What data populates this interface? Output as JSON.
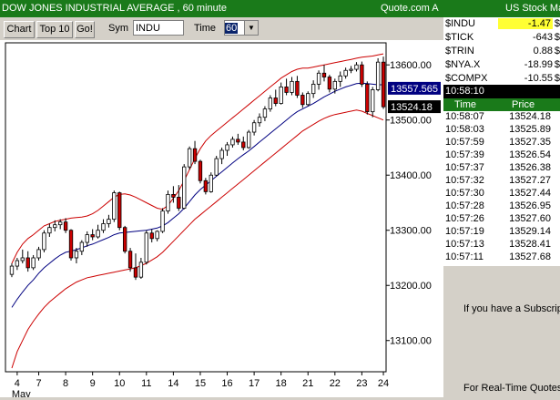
{
  "window": {
    "title": "DOW JONES INDUSTRIAL AVERAGE  , 60 minute",
    "source": "Quote.com",
    "source_suffix": "A"
  },
  "toolbar": {
    "chart_label": "Chart",
    "top10_label": "Top 10",
    "go_label": "Go!",
    "sym_label": "Sym",
    "sym_value": "INDU",
    "time_label": "Time",
    "time_value": "60"
  },
  "price_labels": {
    "upper": "13557.565",
    "last": "13524.18"
  },
  "right_panel": {
    "title": "US Stock Ma",
    "quotes": [
      {
        "symbol": "$INDU",
        "value": "-1.47",
        "highlight": true
      },
      {
        "symbol": "$TICK",
        "value": "-643",
        "highlight": false
      },
      {
        "symbol": "$TRIN",
        "value": "0.88",
        "highlight": false
      },
      {
        "symbol": "$NYA.X",
        "value": "-18.99",
        "highlight": false
      },
      {
        "symbol": "$COMPX",
        "value": "-10.55",
        "highlight": false
      }
    ],
    "clock": "10:58:10",
    "ts_headers": {
      "time": "Time",
      "price": "Price"
    },
    "time_sales": [
      {
        "time": "10:58:07",
        "price": "13524.18"
      },
      {
        "time": "10:58:03",
        "price": "13525.89"
      },
      {
        "time": "10:57:59",
        "price": "13527.35"
      },
      {
        "time": "10:57:39",
        "price": "13526.54"
      },
      {
        "time": "10:57:37",
        "price": "13526.38"
      },
      {
        "time": "10:57:32",
        "price": "13527.27"
      },
      {
        "time": "10:57:30",
        "price": "13527.44"
      },
      {
        "time": "10:57:28",
        "price": "13526.95"
      },
      {
        "time": "10:57:26",
        "price": "13527.60"
      },
      {
        "time": "10:57:19",
        "price": "13529.14"
      },
      {
        "time": "10:57:13",
        "price": "13528.41"
      },
      {
        "time": "10:57:11",
        "price": "13527.68"
      }
    ],
    "subscribe_text": "If you have a Subscript",
    "realtime_text": "For Real-Time Quotes"
  },
  "chart_data": {
    "type": "candlestick",
    "ylim": [
      13050,
      13640
    ],
    "y_ticks": [
      "13600.00",
      "13500.00",
      "13400.00",
      "13300.00",
      "13200.00",
      "13100.00"
    ],
    "x_ticks": [
      "4",
      "7",
      "8",
      "9",
      "10",
      "11",
      "14",
      "15",
      "16",
      "17",
      "18",
      "21",
      "22",
      "23",
      "24"
    ],
    "x_sublabel": "May",
    "bullish_color": "#ffffff",
    "bearish_color": "#cc0000",
    "band_color": "#cc0000",
    "ma_color": "#000080",
    "candles": [
      [
        13220,
        13240,
        13215,
        13235
      ],
      [
        13235,
        13250,
        13228,
        13245
      ],
      [
        13245,
        13265,
        13240,
        13250
      ],
      [
        13250,
        13262,
        13225,
        13232
      ],
      [
        13232,
        13255,
        13228,
        13250
      ],
      [
        13250,
        13270,
        13245,
        13265
      ],
      [
        13265,
        13300,
        13260,
        13295
      ],
      [
        13295,
        13312,
        13288,
        13305
      ],
      [
        13305,
        13318,
        13298,
        13310
      ],
      [
        13310,
        13320,
        13302,
        13315
      ],
      [
        13315,
        13322,
        13295,
        13300
      ],
      [
        13300,
        13302,
        13245,
        13250
      ],
      [
        13250,
        13268,
        13240,
        13262
      ],
      [
        13262,
        13282,
        13255,
        13278
      ],
      [
        13278,
        13298,
        13270,
        13292
      ],
      [
        13292,
        13302,
        13282,
        13288
      ],
      [
        13288,
        13310,
        13285,
        13300
      ],
      [
        13300,
        13320,
        13295,
        13312
      ],
      [
        13312,
        13328,
        13305,
        13320
      ],
      [
        13320,
        13372,
        13315,
        13368
      ],
      [
        13368,
        13370,
        13300,
        13305
      ],
      [
        13305,
        13308,
        13258,
        13262
      ],
      [
        13262,
        13268,
        13225,
        13232
      ],
      [
        13232,
        13258,
        13210,
        13215
      ],
      [
        13215,
        13250,
        13212,
        13242
      ],
      [
        13242,
        13300,
        13238,
        13295
      ],
      [
        13295,
        13302,
        13278,
        13285
      ],
      [
        13285,
        13300,
        13280,
        13298
      ],
      [
        13298,
        13340,
        13295,
        13335
      ],
      [
        13335,
        13372,
        13330,
        13365
      ],
      [
        13365,
        13380,
        13350,
        13360
      ],
      [
        13360,
        13382,
        13335,
        13340
      ],
      [
        13340,
        13420,
        13338,
        13415
      ],
      [
        13415,
        13452,
        13410,
        13448
      ],
      [
        13448,
        13462,
        13420,
        13425
      ],
      [
        13425,
        13428,
        13385,
        13390
      ],
      [
        13390,
        13395,
        13365,
        13370
      ],
      [
        13370,
        13405,
        13368,
        13400
      ],
      [
        13400,
        13435,
        13398,
        13430
      ],
      [
        13430,
        13450,
        13420,
        13445
      ],
      [
        13445,
        13460,
        13435,
        13455
      ],
      [
        13455,
        13470,
        13450,
        13465
      ],
      [
        13465,
        13475,
        13455,
        13460
      ],
      [
        13460,
        13470,
        13445,
        13450
      ],
      [
        13450,
        13482,
        13448,
        13478
      ],
      [
        13478,
        13500,
        13472,
        13495
      ],
      [
        13495,
        13512,
        13488,
        13505
      ],
      [
        13505,
        13525,
        13498,
        13520
      ],
      [
        13520,
        13545,
        13515,
        13540
      ],
      [
        13540,
        13555,
        13525,
        13530
      ],
      [
        13530,
        13568,
        13528,
        13560
      ],
      [
        13560,
        13575,
        13545,
        13550
      ],
      [
        13550,
        13578,
        13545,
        13570
      ],
      [
        13570,
        13580,
        13540,
        13545
      ],
      [
        13545,
        13550,
        13522,
        13528
      ],
      [
        13528,
        13552,
        13525,
        13548
      ],
      [
        13548,
        13572,
        13540,
        13565
      ],
      [
        13565,
        13590,
        13555,
        13585
      ],
      [
        13585,
        13600,
        13570,
        13578
      ],
      [
        13578,
        13582,
        13550,
        13556
      ],
      [
        13556,
        13575,
        13548,
        13570
      ],
      [
        13570,
        13588,
        13560,
        13580
      ],
      [
        13580,
        13595,
        13575,
        13590
      ],
      [
        13590,
        13598,
        13585,
        13592
      ],
      [
        13592,
        13605,
        13588,
        13600
      ],
      [
        13600,
        13606,
        13560,
        13565
      ],
      [
        13565,
        13570,
        13510,
        13515
      ],
      [
        13515,
        13560,
        13505,
        13555
      ],
      [
        13555,
        13612,
        13552,
        13605
      ],
      [
        13605,
        13615,
        13520,
        13524
      ]
    ],
    "ma": [
      13160,
      13175,
      13188,
      13200,
      13210,
      13222,
      13232,
      13240,
      13248,
      13255,
      13260,
      13262,
      13265,
      13268,
      13272,
      13275,
      13279,
      13283,
      13287,
      13292,
      13295,
      13296,
      13297,
      13298,
      13299,
      13300,
      13302,
      13304,
      13308,
      13314,
      13322,
      13330,
      13340,
      13352,
      13364,
      13374,
      13382,
      13390,
      13398,
      13406,
      13414,
      13422,
      13430,
      13437,
      13444,
      13452,
      13460,
      13468,
      13476,
      13484,
      13492,
      13500,
      13508,
      13515,
      13520,
      13525,
      13530,
      13536,
      13542,
      13547,
      13552,
      13556,
      13560,
      13563,
      13566,
      13567,
      13566,
      13565,
      13564,
      13564
    ],
    "upper_band": [
      13240,
      13260,
      13275,
      13285,
      13292,
      13300,
      13308,
      13312,
      13316,
      13318,
      13320,
      13322,
      13323,
      13324,
      13326,
      13330,
      13336,
      13344,
      13352,
      13360,
      13365,
      13366,
      13364,
      13360,
      13355,
      13350,
      13345,
      13340,
      13338,
      13345,
      13358,
      13372,
      13390,
      13410,
      13430,
      13448,
      13462,
      13472,
      13480,
      13488,
      13496,
      13504,
      13512,
      13520,
      13528,
      13536,
      13544,
      13552,
      13560,
      13568,
      13576,
      13582,
      13588,
      13592,
      13594,
      13594,
      13596,
      13598,
      13600,
      13602,
      13604,
      13606,
      13608,
      13610,
      13612,
      13614,
      13615,
      13616,
      13618,
      13620
    ],
    "lower_band": [
      13050,
      13080,
      13100,
      13120,
      13135,
      13148,
      13160,
      13170,
      13178,
      13186,
      13194,
      13200,
      13206,
      13210,
      13214,
      13216,
      13218,
      13220,
      13222,
      13224,
      13226,
      13228,
      13230,
      13232,
      13236,
      13240,
      13246,
      13252,
      13260,
      13270,
      13280,
      13290,
      13300,
      13310,
      13320,
      13328,
      13336,
      13344,
      13352,
      13360,
      13368,
      13376,
      13384,
      13392,
      13400,
      13408,
      13416,
      13424,
      13432,
      13440,
      13448,
      13456,
      13464,
      13472,
      13480,
      13486,
      13492,
      13498,
      13503,
      13507,
      13510,
      13512,
      13514,
      13516,
      13518,
      13516,
      13512,
      13508,
      13504,
      13500
    ]
  }
}
